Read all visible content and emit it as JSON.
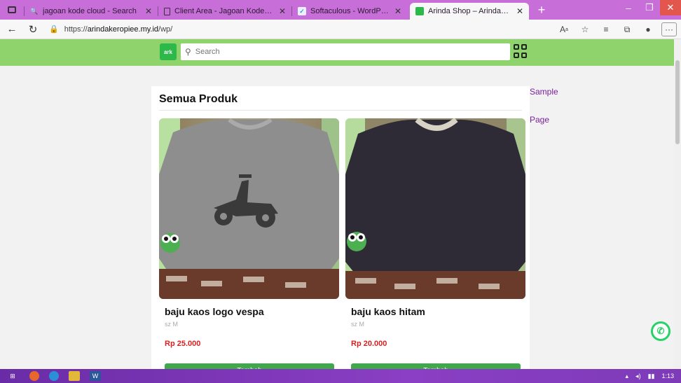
{
  "browser": {
    "tabs": [
      {
        "title": "jagoan kode cloud - Search",
        "icon": "search-icon",
        "active": false
      },
      {
        "title": "Client Area - Jagoan Kode Cloud",
        "icon": "page-icon",
        "active": false
      },
      {
        "title": "Softaculous - WordPress Manage",
        "icon": "softaculous-icon",
        "active": false
      },
      {
        "title": "Arinda Shop – Arinda Keropiee",
        "icon": "site-icon",
        "active": true
      }
    ],
    "new_tab_label": "+",
    "url_prefix": "https://",
    "url_host": "arindakeropiee.my.id",
    "url_path": "/wp/"
  },
  "site": {
    "logo_text": "ark",
    "search_placeholder": "Search",
    "sidebar_links": [
      "Sample",
      "Page"
    ],
    "section_title": "Semua Produk",
    "products": [
      {
        "name": "baju kaos logo vespa",
        "size": "sz M",
        "price": "Rp 25.000",
        "button": "Tambah"
      },
      {
        "name": "baju kaos hitam",
        "size": "sz M",
        "price": "Rp 20.000",
        "button": "Tambah"
      }
    ]
  },
  "taskbar": {
    "clock": "1:13"
  },
  "colors": {
    "tab_bar": "#c86ed8",
    "site_header": "#8fd36c",
    "price": "#d32020",
    "button": "#3fa84a",
    "link": "#7a1f9b"
  }
}
